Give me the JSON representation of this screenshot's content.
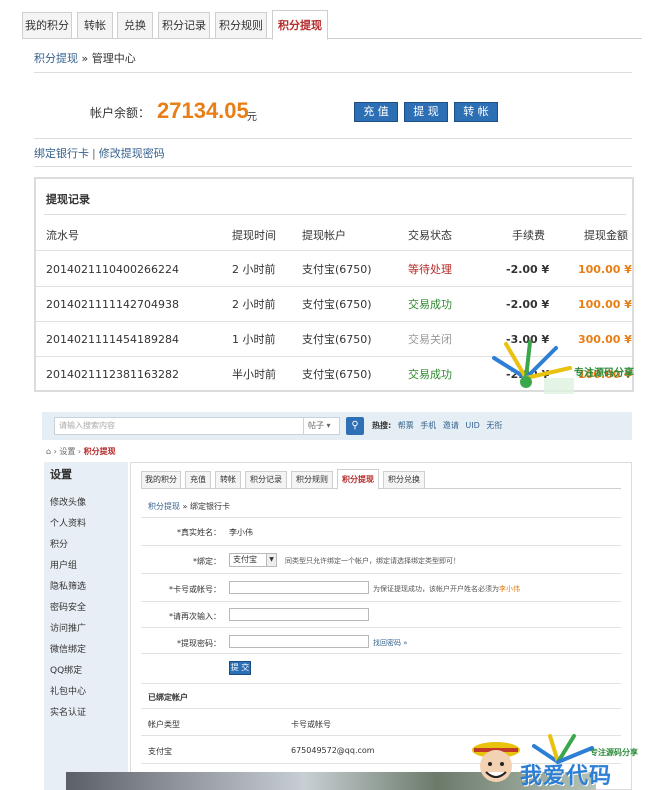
{
  "top": {
    "tabs": [
      "我的积分",
      "转帐",
      "兑换",
      "积分记录",
      "积分规则",
      "积分提现"
    ],
    "active_tab": "积分提现",
    "breadcrumb": {
      "link": "积分提现",
      "sep": "»",
      "current": "管理中心"
    },
    "balance": {
      "label": "帐户余额：",
      "value": "27134.05",
      "unit": "元"
    },
    "buttons": {
      "recharge": "充 值",
      "withdraw": "提 现",
      "transfer": "转 帐"
    },
    "links": {
      "bind_card": "绑定银行卡",
      "change_password": "修改提现密码"
    },
    "record": {
      "title": "提现记录",
      "columns": [
        "流水号",
        "提现时间",
        "提现帐户",
        "交易状态",
        "手续费",
        "提现金额"
      ],
      "rows": [
        {
          "serial": "2014021110400266224",
          "time": "2 小时前",
          "account": "支付宝(6750)",
          "status": "等待处理",
          "status_type": "wait",
          "fee": "-2.00 ¥",
          "amount": "100.00 ¥"
        },
        {
          "serial": "2014021111142704938",
          "time": "2 小时前",
          "account": "支付宝(6750)",
          "status": "交易成功",
          "status_type": "ok",
          "fee": "-2.00 ¥",
          "amount": "100.00 ¥"
        },
        {
          "serial": "2014021111454189284",
          "time": "1 小时前",
          "account": "支付宝(6750)",
          "status": "交易关闭",
          "status_type": "close",
          "fee": "-3.00 ¥",
          "amount": "300.00 ¥"
        },
        {
          "serial": "2014021112381163282",
          "time": "半小时前",
          "account": "支付宝(6750)",
          "status": "交易成功",
          "status_type": "ok",
          "fee": "-2.00 ¥",
          "amount": "100.00 ¥"
        }
      ]
    }
  },
  "bottom": {
    "search": {
      "placeholder": "请输入搜索内容",
      "type": "帖子",
      "hot_label": "热搜:",
      "hot_items": [
        "帮票",
        "手机",
        "邀请",
        "UID",
        "无衔"
      ]
    },
    "breadcrumb": {
      "home": "⌂",
      "sep1": "›",
      "settings": "设置",
      "sep2": "›",
      "current": "积分提现"
    },
    "sidebar": {
      "title": "设置",
      "items": [
        "修改头像",
        "个人资料",
        "积分",
        "用户组",
        "隐私筛选",
        "密码安全",
        "访问推广",
        "微信绑定",
        "QQ绑定",
        "礼包中心",
        "实名认证"
      ]
    },
    "tabs": [
      "我的积分",
      "充值",
      "转帐",
      "积分记录",
      "积分规则",
      "积分提现",
      "积分兑换"
    ],
    "active_tab": "积分提现",
    "content_breadcrumb": {
      "link": "积分提现",
      "sep": "»",
      "current": "绑定银行卡"
    },
    "form": {
      "real_name_label": "*真实姓名：",
      "real_name_value": "李小伟",
      "bind_label": "*绑定：",
      "bind_value": "支付宝",
      "bind_hint": "同类型只允许绑定一个帐户，绑定请选择绑定类型即可！",
      "card_label": "*卡号或帐号：",
      "card_hint": "为保证提现成功，该帐户开户姓名必须为",
      "card_hint_name": "李小伟",
      "repeat_label": "*请再次输入：",
      "password_label": "*提现密码：",
      "find_password": "找回密码 »",
      "submit": "提 交"
    },
    "bound": {
      "title": "已绑定帐户",
      "columns": [
        "帐户类型",
        "卡号或帐号"
      ],
      "rows": [
        {
          "type": "支付宝",
          "account": "675049572@qq.com"
        }
      ]
    }
  },
  "watermark": {
    "small": "专注源码分享",
    "big": "我爱代码",
    "big_sub": "专注源码分享"
  }
}
